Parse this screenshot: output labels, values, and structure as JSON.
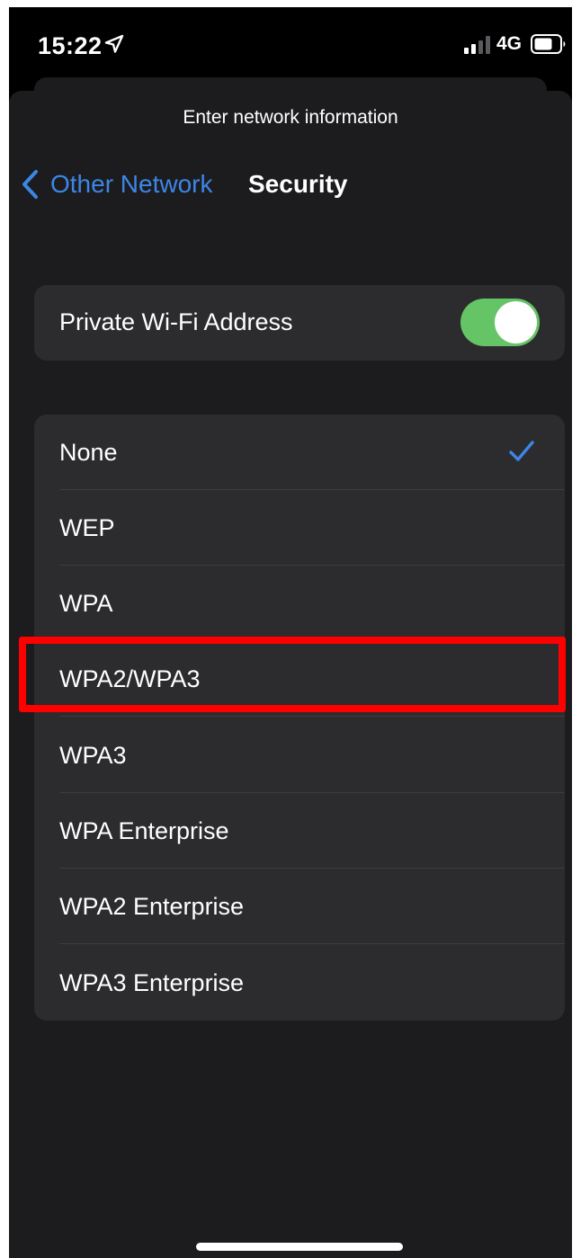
{
  "status_bar": {
    "time": "15:22",
    "network": "4G",
    "icons": [
      "location-arrow-icon",
      "cellular-signal-icon",
      "battery-icon"
    ]
  },
  "sheet": {
    "title": "Enter network information"
  },
  "nav": {
    "back_label": "Other Network",
    "title": "Security"
  },
  "private_wifi": {
    "label": "Private Wi-Fi Address",
    "enabled": true
  },
  "security_options": {
    "items": [
      {
        "label": "None",
        "selected": true
      },
      {
        "label": "WEP",
        "selected": false
      },
      {
        "label": "WPA",
        "selected": false
      },
      {
        "label": "WPA2/WPA3",
        "selected": false,
        "highlighted": true
      },
      {
        "label": "WPA3",
        "selected": false
      },
      {
        "label": "WPA Enterprise",
        "selected": false
      },
      {
        "label": "WPA2 Enterprise",
        "selected": false
      },
      {
        "label": "WPA3 Enterprise",
        "selected": false
      }
    ]
  },
  "colors": {
    "accent": "#3c86e6",
    "toggle_on": "#65c466",
    "highlight": "#ff0000",
    "background": "#1c1c1e",
    "card": "#2c2c2e"
  }
}
